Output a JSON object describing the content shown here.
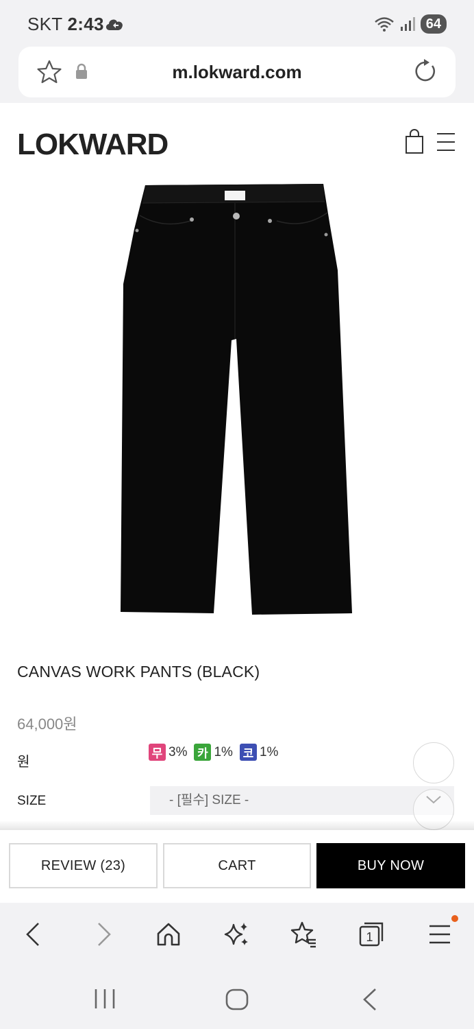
{
  "status_bar": {
    "carrier": "SKT",
    "time": "2:43",
    "battery": "64"
  },
  "browser": {
    "url": "m.lokward.com"
  },
  "site": {
    "logo": "LOKWARD"
  },
  "product": {
    "title": "CANVAS WORK PANTS (BLACK)",
    "price": "64,000원",
    "currency_label": "원",
    "rewards": [
      {
        "badge": "무",
        "color": "#e0457b",
        "rate": "3%"
      },
      {
        "badge": "카",
        "color": "#3aa53a",
        "rate": "1%"
      },
      {
        "badge": "코",
        "color": "#3d4fb3",
        "rate": "1%"
      }
    ],
    "size_label": "SIZE",
    "size_select_value": "- [필수] SIZE -"
  },
  "actions": {
    "review": "REVIEW (23)",
    "cart": "CART",
    "buy_now": "BUY NOW"
  },
  "toolbar": {
    "tabs_count": "1"
  }
}
